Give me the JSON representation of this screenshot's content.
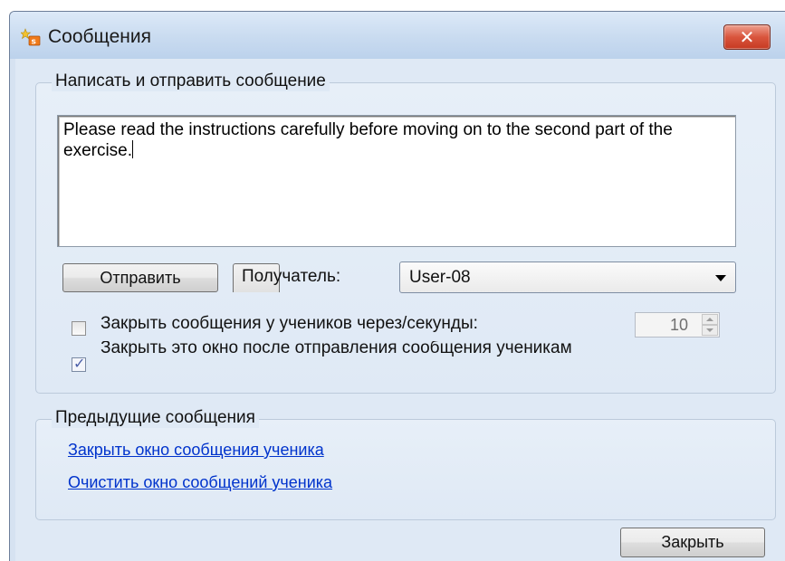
{
  "window": {
    "title": "Сообщения",
    "close_symbol": "✕"
  },
  "compose": {
    "group_label": "Написать и отправить сообщение",
    "message_text": "Please read the instructions carefully before moving on to the second part of the exercise.",
    "send_label": "Отправить",
    "recipient_label": "Получатель:",
    "recipient_value": "User-08"
  },
  "options": {
    "close_after_seconds_label": "Закрыть сообщения у учеников через/секунды:",
    "close_after_seconds_checked": false,
    "seconds_value": "10",
    "close_window_label": "Закрыть это окно после отправления сообщения ученикам",
    "close_window_checked": true
  },
  "previous": {
    "group_label": "Предыдущие сообщения",
    "links": [
      "Закрыть окно сообщения ученика",
      "Очистить окно сообщений ученика"
    ]
  },
  "footer": {
    "close_label": "Закрыть"
  },
  "icons": {
    "app": "messages-app-icon",
    "close": "close-icon",
    "dropdown": "chevron-down-icon",
    "check": "checkmark-icon"
  },
  "colors": {
    "window_bg": "#dfe9f5",
    "close_button": "#d9553d",
    "link": "#0033cc"
  }
}
